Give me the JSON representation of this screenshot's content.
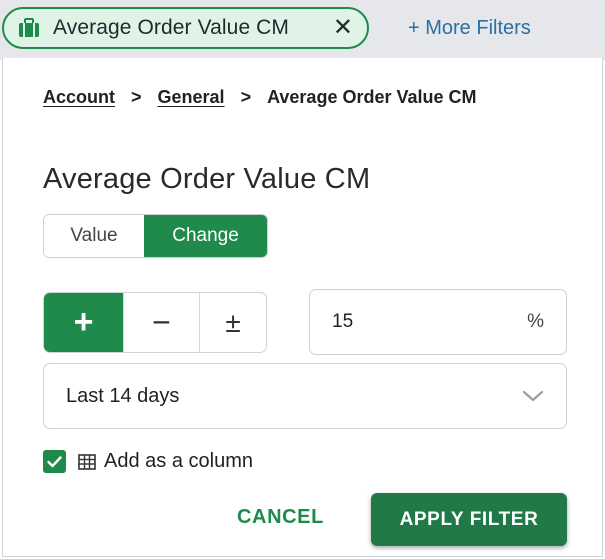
{
  "filter_chip": {
    "icon": "briefcase-icon",
    "label": "Average Order Value CM",
    "close_glyph": "✕"
  },
  "more_filters": {
    "label": "+ More Filters"
  },
  "breadcrumb": {
    "items": [
      "Account",
      "General",
      "Average Order Value CM"
    ],
    "separator": ">"
  },
  "title": "Average Order Value CM",
  "mode_toggle": {
    "options": [
      "Value",
      "Change"
    ],
    "selected": "Change"
  },
  "operators": {
    "items": [
      "+",
      "−",
      "±"
    ],
    "selected": "+"
  },
  "change_input": {
    "value": "15",
    "unit": "%"
  },
  "period_select": {
    "selected": "Last 14 days",
    "icon": "chevron-down-icon"
  },
  "add_column": {
    "checked": true,
    "icon": "table-icon",
    "label": "Add as a column"
  },
  "actions": {
    "cancel_label": "CANCEL",
    "apply_label": "APPLY FILTER"
  },
  "colors": {
    "accent": "#1f8a4c",
    "chip_bg": "#dff3e6",
    "link_blue": "#2a6fa6",
    "topbar_bg": "#e5e7ea"
  }
}
